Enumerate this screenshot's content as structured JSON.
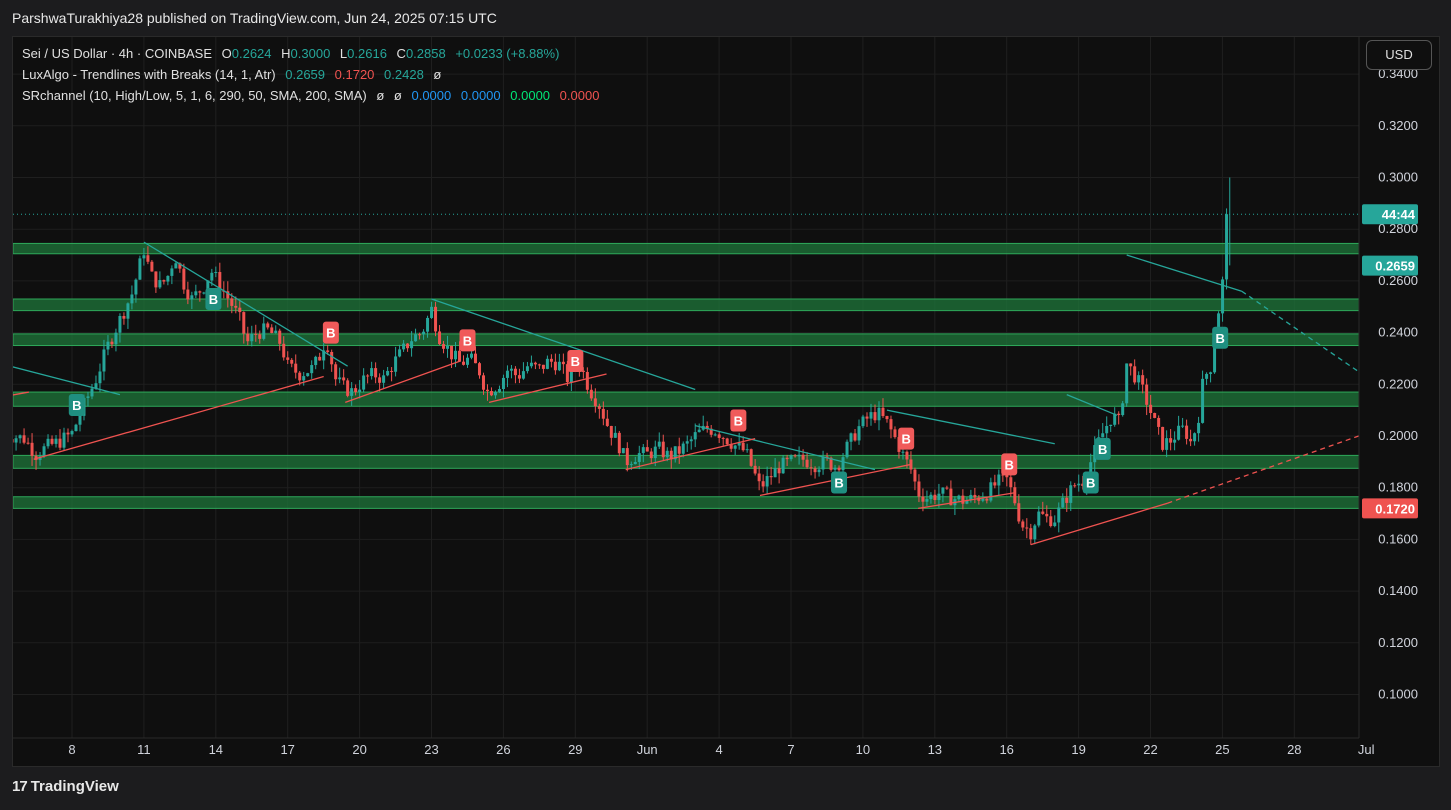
{
  "header": {
    "publisher": "ParshwaTurakhiya28 published on TradingView.com, Jun 24, 2025 07:15 UTC"
  },
  "legend": {
    "symbol": "Sei / US Dollar · 4h · COINBASE",
    "o_label": "O",
    "o_value": "0.2624",
    "h_label": "H",
    "h_value": "0.3000",
    "l_label": "L",
    "l_value": "0.2616",
    "c_label": "C",
    "c_value": "0.2858",
    "change": "+0.0233 (+8.88%)",
    "luxalgo_name": "LuxAlgo - Trendlines with Breaks (14, 1, Atr)",
    "luxalgo_values": [
      "0.2659",
      "0.1720",
      "0.2428",
      "ø"
    ],
    "sr_name": "SRchannel (10, High/Low, 5, 1, 6, 290, 50, SMA, 200, SMA)",
    "sr_values": [
      "ø",
      "ø",
      "0.0000",
      "0.0000",
      "0.0000",
      "0.0000"
    ]
  },
  "currency_button": "USD",
  "footer": {
    "logo": "17",
    "brand": "TradingView"
  },
  "colors": {
    "up": "#26a69a",
    "down": "#ef5350",
    "zone": "#1e7a3c",
    "blue": "#2196f3",
    "green": "#00e676"
  },
  "chart_data": {
    "type": "candlestick",
    "title": "Sei / US Dollar",
    "timeframe": "4h",
    "ylim": [
      0.08,
      0.34
    ],
    "y_ticks": [
      "0.1000",
      "0.1200",
      "0.1400",
      "0.1600",
      "0.1800",
      "0.2000",
      "0.2200",
      "0.2400",
      "0.2600",
      "0.2800",
      "0.3000",
      "0.3200",
      "0.3400"
    ],
    "x_ticks": [
      "8",
      "11",
      "14",
      "17",
      "20",
      "23",
      "26",
      "29",
      "Jun",
      "4",
      "7",
      "10",
      "13",
      "16",
      "19",
      "22",
      "25",
      "28",
      "Jul"
    ],
    "price_labels": [
      {
        "text": "44:44",
        "value": 0.2858,
        "color": "#26a69a"
      },
      {
        "text": "0.2659",
        "value": 0.2659,
        "color": "#26a69a"
      },
      {
        "text": "0.1720",
        "value": 0.172,
        "color": "#ef5350"
      }
    ],
    "sr_zones": [
      {
        "low": 0.2705,
        "high": 0.2745
      },
      {
        "low": 0.2485,
        "high": 0.253
      },
      {
        "low": 0.235,
        "high": 0.2395
      },
      {
        "low": 0.2115,
        "high": 0.217
      },
      {
        "low": 0.1875,
        "high": 0.1925
      },
      {
        "low": 0.172,
        "high": 0.1765
      }
    ],
    "path": [
      [
        5.0,
        0.201
      ],
      [
        6.0,
        0.199
      ],
      [
        6.5,
        0.193
      ],
      [
        7.0,
        0.196
      ],
      [
        7.5,
        0.198
      ],
      [
        8.0,
        0.201
      ],
      [
        8.5,
        0.212
      ],
      [
        9.0,
        0.222
      ],
      [
        9.5,
        0.235
      ],
      [
        10.0,
        0.245
      ],
      [
        10.5,
        0.255
      ],
      [
        11.0,
        0.272
      ],
      [
        11.3,
        0.262
      ],
      [
        11.7,
        0.258
      ],
      [
        12.0,
        0.262
      ],
      [
        12.3,
        0.27
      ],
      [
        12.7,
        0.258
      ],
      [
        13.0,
        0.253
      ],
      [
        13.5,
        0.258
      ],
      [
        13.8,
        0.264
      ],
      [
        14.2,
        0.258
      ],
      [
        14.6,
        0.252
      ],
      [
        15.0,
        0.245
      ],
      [
        15.3,
        0.236
      ],
      [
        15.7,
        0.24
      ],
      [
        16.2,
        0.241
      ],
      [
        16.7,
        0.236
      ],
      [
        17.0,
        0.227
      ],
      [
        17.5,
        0.224
      ],
      [
        18.0,
        0.226
      ],
      [
        18.3,
        0.23
      ],
      [
        18.6,
        0.238
      ],
      [
        19.0,
        0.222
      ],
      [
        19.3,
        0.219
      ],
      [
        19.7,
        0.217
      ],
      [
        20.2,
        0.222
      ],
      [
        20.6,
        0.224
      ],
      [
        21.0,
        0.222
      ],
      [
        21.4,
        0.228
      ],
      [
        21.8,
        0.233
      ],
      [
        22.2,
        0.238
      ],
      [
        22.6,
        0.24
      ],
      [
        23.0,
        0.249
      ],
      [
        23.3,
        0.239
      ],
      [
        23.8,
        0.232
      ],
      [
        24.2,
        0.228
      ],
      [
        24.6,
        0.23
      ],
      [
        25.0,
        0.225
      ],
      [
        25.3,
        0.217
      ],
      [
        25.8,
        0.22
      ],
      [
        26.2,
        0.226
      ],
      [
        26.6,
        0.223
      ],
      [
        27.0,
        0.227
      ],
      [
        27.5,
        0.226
      ],
      [
        27.9,
        0.229
      ],
      [
        28.3,
        0.228
      ],
      [
        28.7,
        0.222
      ],
      [
        29.0,
        0.23
      ],
      [
        29.3,
        0.225
      ],
      [
        29.6,
        0.218
      ],
      [
        30.0,
        0.212
      ],
      [
        30.4,
        0.203
      ],
      [
        30.8,
        0.197
      ],
      [
        31.1,
        0.19
      ],
      [
        31.6,
        0.193
      ],
      [
        32.0,
        0.193
      ],
      [
        32.5,
        0.195
      ],
      [
        32.9,
        0.192
      ],
      [
        33.3,
        0.194
      ],
      [
        33.7,
        0.197
      ],
      [
        34.1,
        0.201
      ],
      [
        34.5,
        0.203
      ],
      [
        34.9,
        0.202
      ],
      [
        35.3,
        0.199
      ],
      [
        35.7,
        0.196
      ],
      [
        36.1,
        0.194
      ],
      [
        36.4,
        0.187
      ],
      [
        36.7,
        0.18
      ],
      [
        37.1,
        0.184
      ],
      [
        37.5,
        0.188
      ],
      [
        38.0,
        0.19
      ],
      [
        38.5,
        0.191
      ],
      [
        39.0,
        0.189
      ],
      [
        39.5,
        0.19
      ],
      [
        39.9,
        0.188
      ],
      [
        40.3,
        0.195
      ],
      [
        40.8,
        0.203
      ],
      [
        41.2,
        0.207
      ],
      [
        41.6,
        0.209
      ],
      [
        42.0,
        0.205
      ],
      [
        42.4,
        0.198
      ],
      [
        42.7,
        0.192
      ],
      [
        43.0,
        0.187
      ],
      [
        43.3,
        0.178
      ],
      [
        43.7,
        0.176
      ],
      [
        44.2,
        0.178
      ],
      [
        44.7,
        0.176
      ],
      [
        45.2,
        0.175
      ],
      [
        45.7,
        0.176
      ],
      [
        46.2,
        0.178
      ],
      [
        46.6,
        0.182
      ],
      [
        47.0,
        0.183
      ],
      [
        47.3,
        0.176
      ],
      [
        47.6,
        0.166
      ],
      [
        48.0,
        0.163
      ],
      [
        48.3,
        0.17
      ],
      [
        48.7,
        0.168
      ],
      [
        49.0,
        0.168
      ],
      [
        49.4,
        0.175
      ],
      [
        49.8,
        0.181
      ],
      [
        50.2,
        0.183
      ],
      [
        50.5,
        0.19
      ],
      [
        50.8,
        0.197
      ],
      [
        51.1,
        0.203
      ],
      [
        51.4,
        0.208
      ],
      [
        51.7,
        0.205
      ],
      [
        52.0,
        0.228
      ],
      [
        52.3,
        0.224
      ],
      [
        52.6,
        0.219
      ],
      [
        52.9,
        0.212
      ],
      [
        53.2,
        0.204
      ],
      [
        53.5,
        0.197
      ],
      [
        53.8,
        0.198
      ],
      [
        54.1,
        0.201
      ],
      [
        54.4,
        0.203
      ],
      [
        54.7,
        0.197
      ],
      [
        55.0,
        0.208
      ],
      [
        55.2,
        0.222
      ],
      [
        55.5,
        0.227
      ],
      [
        55.7,
        0.24
      ],
      [
        55.9,
        0.253
      ],
      [
        56.1,
        0.266
      ],
      [
        56.3,
        0.2858
      ]
    ],
    "trendlines": [
      {
        "color": "#26a69a",
        "x1": 5.0,
        "y1": 0.228,
        "x2": 10.0,
        "y2": 0.216
      },
      {
        "color": "#26a69a",
        "x1": 11.0,
        "y1": 0.275,
        "x2": 19.5,
        "y2": 0.227
      },
      {
        "color": "#26a69a",
        "x1": 23.0,
        "y1": 0.253,
        "x2": 34.0,
        "y2": 0.218
      },
      {
        "color": "#26a69a",
        "x1": 34.0,
        "y1": 0.204,
        "x2": 41.5,
        "y2": 0.187
      },
      {
        "color": "#26a69a",
        "x1": 42.0,
        "y1": 0.21,
        "x2": 49.0,
        "y2": 0.197
      },
      {
        "color": "#26a69a",
        "x1": 49.5,
        "y1": 0.216,
        "x2": 51.6,
        "y2": 0.208
      },
      {
        "color": "#26a69a",
        "x1": 52.0,
        "y1": 0.27,
        "x2": 56.8,
        "y2": 0.256
      },
      {
        "color": "#26a69a",
        "x1": 56.8,
        "y1": 0.256,
        "x2": 62.6,
        "y2": 0.219,
        "dashed": true
      },
      {
        "color": "#ef5350",
        "x1": 5.0,
        "y1": 0.215,
        "x2": 6.2,
        "y2": 0.217
      },
      {
        "color": "#ef5350",
        "x1": 6.4,
        "y1": 0.191,
        "x2": 18.5,
        "y2": 0.223
      },
      {
        "color": "#ef5350",
        "x1": 19.4,
        "y1": 0.213,
        "x2": 24.2,
        "y2": 0.229
      },
      {
        "color": "#ef5350",
        "x1": 25.4,
        "y1": 0.213,
        "x2": 30.3,
        "y2": 0.224
      },
      {
        "color": "#ef5350",
        "x1": 31.1,
        "y1": 0.187,
        "x2": 36.5,
        "y2": 0.199
      },
      {
        "color": "#ef5350",
        "x1": 36.7,
        "y1": 0.177,
        "x2": 43.0,
        "y2": 0.189
      },
      {
        "color": "#ef5350",
        "x1": 43.3,
        "y1": 0.172,
        "x2": 47.3,
        "y2": 0.178
      },
      {
        "color": "#ef5350",
        "x1": 48.0,
        "y1": 0.158,
        "x2": 53.7,
        "y2": 0.174
      },
      {
        "color": "#ef5350",
        "x1": 53.7,
        "y1": 0.174,
        "x2": 62.6,
        "y2": 0.203,
        "dashed": true
      }
    ],
    "markers": [
      {
        "label": "B",
        "type": "bull",
        "x": 8.2,
        "y": 0.212
      },
      {
        "label": "B",
        "type": "bull",
        "x": 13.9,
        "y": 0.253
      },
      {
        "label": "B",
        "type": "bear",
        "x": 18.8,
        "y": 0.24
      },
      {
        "label": "B",
        "type": "bear",
        "x": 24.5,
        "y": 0.237
      },
      {
        "label": "B",
        "type": "bear",
        "x": 29.0,
        "y": 0.229
      },
      {
        "label": "B",
        "type": "bear",
        "x": 35.8,
        "y": 0.206
      },
      {
        "label": "B",
        "type": "bull",
        "x": 40.0,
        "y": 0.182
      },
      {
        "label": "B",
        "type": "bear",
        "x": 42.8,
        "y": 0.199
      },
      {
        "label": "B",
        "type": "bear",
        "x": 47.1,
        "y": 0.189
      },
      {
        "label": "B",
        "type": "bull",
        "x": 50.5,
        "y": 0.182
      },
      {
        "label": "B",
        "type": "bull",
        "x": 51.0,
        "y": 0.195
      },
      {
        "label": "B",
        "type": "bull",
        "x": 55.9,
        "y": 0.238
      }
    ]
  }
}
